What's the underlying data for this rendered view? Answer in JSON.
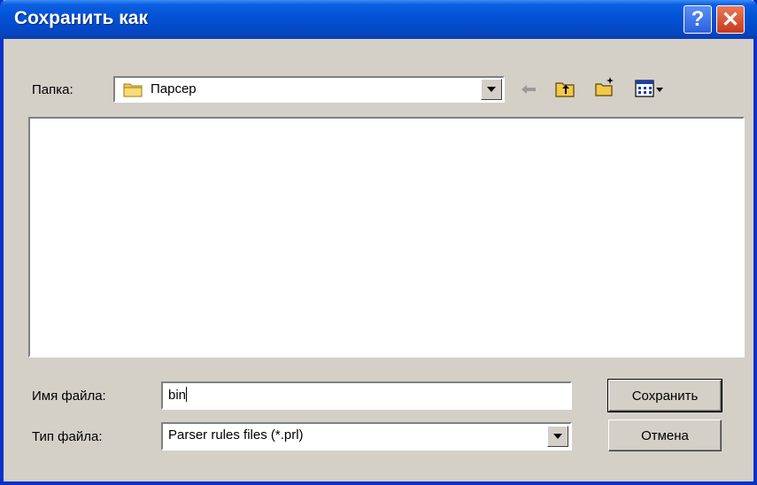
{
  "window": {
    "title": "Сохранить как"
  },
  "titlebar_buttons": {
    "help": "?",
    "close": "✕"
  },
  "location": {
    "label": "Папка:",
    "current": "Парсер",
    "icon": "folder-icon"
  },
  "toolbar": [
    "back-arrow-icon",
    "up-folder-icon",
    "new-folder-icon",
    "view-menu-icon"
  ],
  "file_name": {
    "label": "Имя файла:",
    "value": "bin"
  },
  "file_type": {
    "label": "Тип файла:",
    "selected": "Parser rules files (*.prl)"
  },
  "buttons": {
    "save": "Сохранить",
    "cancel": "Отмена"
  },
  "colors": {
    "titlebar": "#0453d6",
    "dialog_bg": "#d4d0c8",
    "folder": "#f2c94c"
  }
}
